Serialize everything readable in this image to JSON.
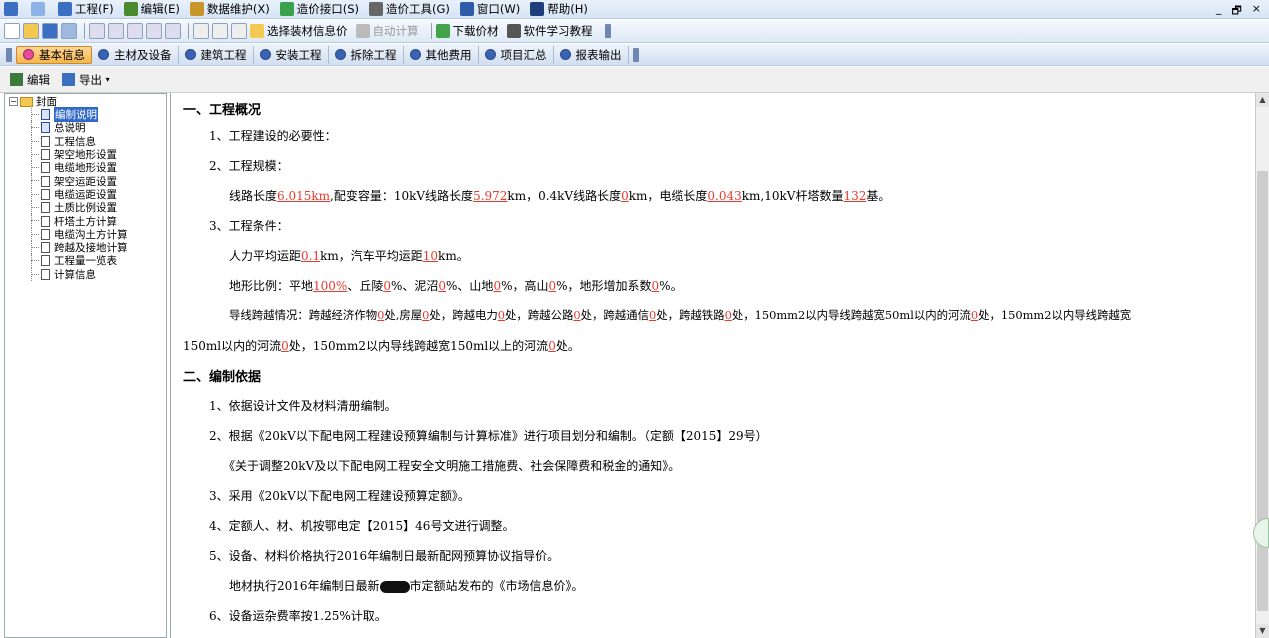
{
  "menubar": {
    "items": [
      {
        "label": "工程(F)",
        "icon": "project-icon",
        "color": "#3a6fc2"
      },
      {
        "label": "编辑(E)",
        "icon": "edit-icon",
        "color": "#4b8a2c"
      },
      {
        "label": "数据维护(X)",
        "icon": "data-icon",
        "color": "#c9962a"
      },
      {
        "label": "造价接口(S)",
        "icon": "interface-icon",
        "color": "#39a04b"
      },
      {
        "label": "造价工具(G)",
        "icon": "tool-icon",
        "color": "#666"
      },
      {
        "label": "窗口(W)",
        "icon": "window-icon",
        "color": "#2d5ca8"
      },
      {
        "label": "帮助(H)",
        "icon": "help-icon",
        "color": "#1f3f7a"
      }
    ],
    "window_controls": [
      "_",
      "♂",
      "×"
    ]
  },
  "toolbar1": {
    "select_material": "选择装材信息价",
    "auto_calc": "自动计算",
    "download_price": "下载价材",
    "tutorial": "软件学习教程"
  },
  "tabs": [
    {
      "label": "基本信息",
      "active": true
    },
    {
      "label": "主材及设备",
      "active": false
    },
    {
      "label": "建筑工程",
      "active": false
    },
    {
      "label": "安装工程",
      "active": false
    },
    {
      "label": "拆除工程",
      "active": false
    },
    {
      "label": "其他费用",
      "active": false
    },
    {
      "label": "项目汇总",
      "active": false
    },
    {
      "label": "报表输出",
      "active": false
    }
  ],
  "subbar": {
    "edit": "编辑",
    "export": "导出"
  },
  "tree": {
    "root": "封面",
    "items": [
      {
        "label": "编制说明",
        "selected": true,
        "blue": true
      },
      {
        "label": "总说明",
        "selected": false,
        "blue": true
      },
      {
        "label": "工程信息",
        "selected": false,
        "blue": false
      },
      {
        "label": "架空地形设置",
        "selected": false,
        "blue": false
      },
      {
        "label": "电缆地形设置",
        "selected": false,
        "blue": false
      },
      {
        "label": "架空运距设置",
        "selected": false,
        "blue": false
      },
      {
        "label": "电缆运距设置",
        "selected": false,
        "blue": false
      },
      {
        "label": "土质比例设置",
        "selected": false,
        "blue": false
      },
      {
        "label": "杆塔土方计算",
        "selected": false,
        "blue": false
      },
      {
        "label": "电缆沟土方计算",
        "selected": false,
        "blue": false
      },
      {
        "label": "跨越及接地计算",
        "selected": false,
        "blue": false
      },
      {
        "label": "工程量一览表",
        "selected": false,
        "blue": false
      },
      {
        "label": "计算信息",
        "selected": false,
        "blue": false
      }
    ]
  },
  "doc": {
    "s1_title": "一、工程概况",
    "s1_1": "1、工程建设的必要性：",
    "s1_2": "2、工程规模：",
    "scale": {
      "p1": "线路长度",
      "v1": "6.015km",
      "p2": ",配变容量：10kV线路长度",
      "v2": "5.972",
      "p3": "km，0.4kV线路长度",
      "v3": "0",
      "p4": "km，电缆长度",
      "v4": "0.043",
      "p5": "km,10kV杆塔数量",
      "v5": "132",
      "p6": "基。"
    },
    "s1_3": "3、工程条件：",
    "haul": {
      "p1": "人力平均运距",
      "v1": "0.1",
      "p2": "km，汽车平均运距",
      "v2": "10",
      "p3": "km。"
    },
    "terrain": {
      "p1": "地形比例：平地",
      "v1": "100%",
      "p2": "、丘陵",
      "v2": "0",
      "p3": "%、泥沼",
      "v3": "0",
      "p4": "%、山地",
      "v4": "0",
      "p5": "%，高山",
      "v5": "0",
      "p6": "%，地形增加系数",
      "v6": "0",
      "p7": "%。"
    },
    "cross": {
      "p1": "导线跨越情况：跨越经济作物",
      "v1": "0",
      "p2": "处,房屋",
      "v2": "0",
      "p3": "处，跨越电力",
      "v3": "0",
      "p4": "处，跨越公路",
      "v4": "0",
      "p5": "处，跨越通信",
      "v5": "0",
      "p6": "处，跨越铁路",
      "v6": "0",
      "p7": "处，150mm2以内导线跨越宽50ml以内的河流",
      "v7": "0",
      "p8": "处，150mm2以内导线跨越宽"
    },
    "cross2": {
      "p1": "150ml以内的河流",
      "v1": "0",
      "p2": "处，150mm2以内导线跨越宽150ml以上的河流",
      "v2": "0",
      "p3": "处。"
    },
    "s2_title": "二、编制依据",
    "b1": "1、依据设计文件及材料清册编制。",
    "b2": "2、根据《20kV以下配电网工程建设预算编制与计算标准》进行项目划分和编制。（定额【2015】29号）",
    "b2b": "《关于调整20kV及以下配电网工程安全文明施工措施费、社会保障费和税金的通知》。",
    "b3": "3、采用《20kV以下配电网工程建设预算定额》。",
    "b4": "4、定额人、材、机按鄂电定【2015】46号文进行调整。",
    "b5": "5、设备、材料价格执行2016年编制日最新配网预算协议指导价。",
    "b5b_1": "地材执行2016年编制日最新",
    "b5b_2": "市定额站发布的《市场信息价》。",
    "b6": "6、设备运杂费率按1.25%计取。"
  }
}
